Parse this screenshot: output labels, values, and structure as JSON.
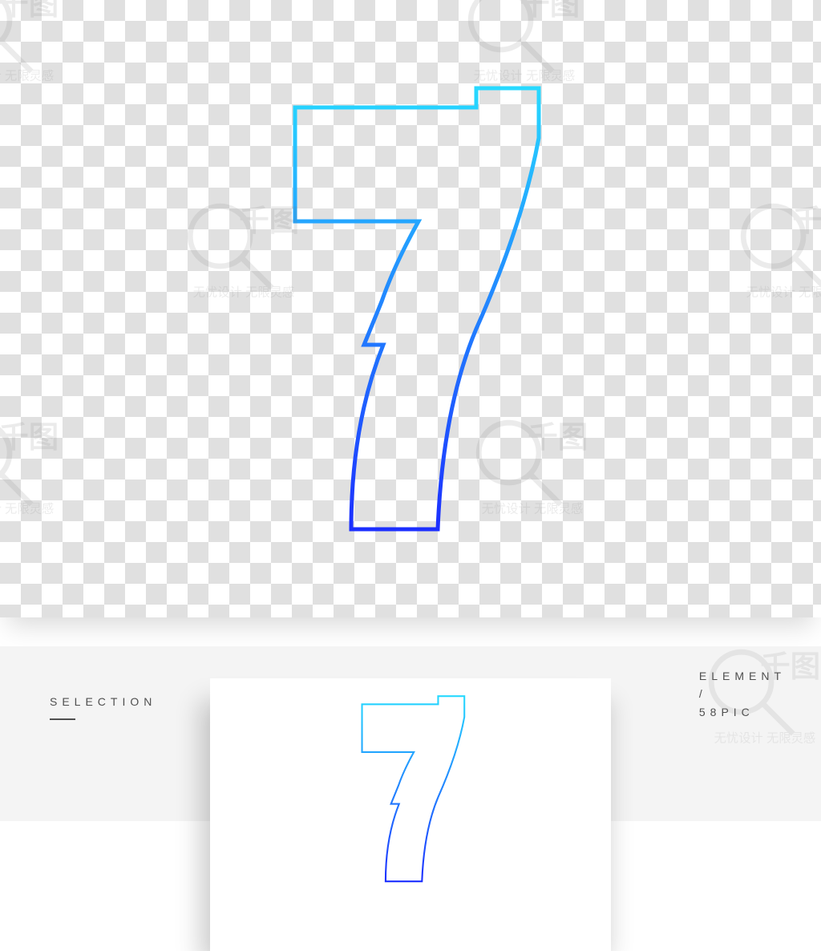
{
  "preview": {
    "glyph_name": "number-7-outline",
    "gradient": {
      "top": "#27d9ff",
      "bottom": "#1c2fff"
    }
  },
  "watermark": {
    "brand_cn": "千图",
    "tagline_cn": "无忧设计 无限灵感"
  },
  "strip": {
    "left_label": "SELECTION",
    "right_label_line1": "ELEMENT",
    "right_label_line2": "/",
    "right_label_line3": "58PIC"
  }
}
